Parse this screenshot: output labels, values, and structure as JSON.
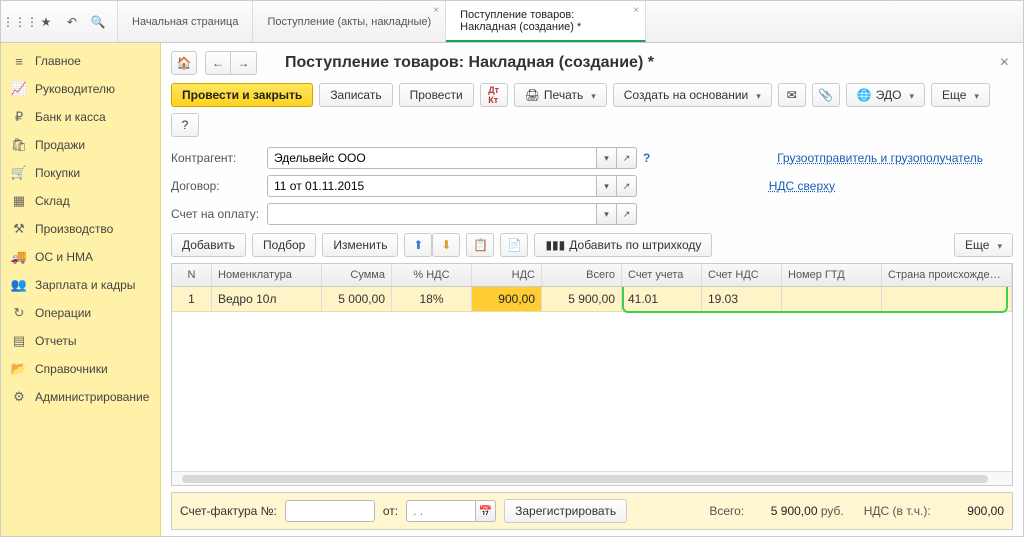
{
  "topIcons": [
    "apps",
    "star",
    "link",
    "search"
  ],
  "tabs": [
    {
      "label": "Начальная страница",
      "active": false,
      "closable": false
    },
    {
      "label": "Поступление (акты, накладные)",
      "active": false,
      "closable": true
    },
    {
      "label": "Поступление товаров: Накладная (создание) *",
      "active": true,
      "closable": true
    }
  ],
  "sidebar": {
    "items": [
      {
        "icon": "≡",
        "label": "Главное"
      },
      {
        "icon": "📈",
        "label": "Руководителю"
      },
      {
        "icon": "₽",
        "label": "Банк и касса"
      },
      {
        "icon": "🛍",
        "label": "Продажи"
      },
      {
        "icon": "🛒",
        "label": "Покупки"
      },
      {
        "icon": "▦",
        "label": "Склад"
      },
      {
        "icon": "⚒",
        "label": "Производство"
      },
      {
        "icon": "🚚",
        "label": "ОС и НМА"
      },
      {
        "icon": "👥",
        "label": "Зарплата и кадры"
      },
      {
        "icon": "↻",
        "label": "Операции"
      },
      {
        "icon": "▤",
        "label": "Отчеты"
      },
      {
        "icon": "📂",
        "label": "Справочники"
      },
      {
        "icon": "⚙",
        "label": "Администрирование"
      }
    ]
  },
  "document": {
    "title": "Поступление товаров: Накладная (создание) *"
  },
  "toolbar": {
    "post_close": "Провести и закрыть",
    "save": "Записать",
    "post": "Провести",
    "print": "Печать",
    "create_based": "Создать на основании",
    "edo": "ЭДО",
    "more": "Еще",
    "dtkt": "Дт/Кт"
  },
  "fields": {
    "contragent_label": "Контрагент:",
    "contragent_value": "Эдельвейс ООО",
    "contract_label": "Договор:",
    "contract_value": "11 от 01.11.2015",
    "invoice_label": "Счет на оплату:",
    "invoice_value": "",
    "gruz_link": "Грузоотправитель и грузополучатель",
    "nds_link": "НДС сверху",
    "help": "?"
  },
  "tblToolbar": {
    "add": "Добавить",
    "select": "Подбор",
    "edit": "Изменить",
    "barcode": "Добавить по штрихкоду",
    "more": "Еще"
  },
  "table": {
    "headers": {
      "n": "N",
      "nom": "Номенклатура",
      "sum": "Сумма",
      "pct": "% НДС",
      "nds": "НДС",
      "total": "Всего",
      "acct": "Счет учета",
      "ndsacct": "Счет НДС",
      "gtd": "Номер ГТД",
      "country": "Страна происхождения"
    },
    "rows": [
      {
        "n": "1",
        "nom": "Ведро 10л",
        "sum": "5 000,00",
        "pct": "18%",
        "nds": "900,00",
        "total": "5 900,00",
        "acct": "41.01",
        "ndsacct": "19.03",
        "gtd": "",
        "country": ""
      }
    ]
  },
  "footer": {
    "sf_label": "Счет-фактура №:",
    "sf_value": "",
    "from_label": "от:",
    "date_placeholder": ". .",
    "register": "Зарегистрировать",
    "total_label": "Всего:",
    "total_value": "5 900,00",
    "currency": "руб.",
    "nds_label": "НДС (в т.ч.):",
    "nds_value": "900,00"
  }
}
